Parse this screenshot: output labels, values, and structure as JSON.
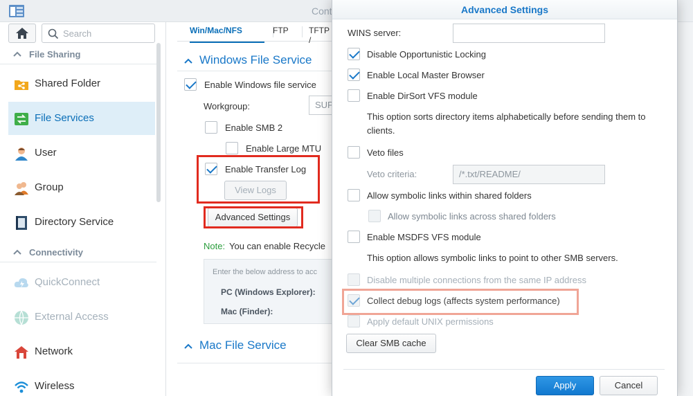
{
  "app": {
    "title": "Cont"
  },
  "sidebar": {
    "search_placeholder": "Search",
    "sections": [
      {
        "label": "File Sharing"
      },
      {
        "label": "Connectivity"
      }
    ],
    "items": [
      {
        "label": "Shared Folder"
      },
      {
        "label": "File Services"
      },
      {
        "label": "User"
      },
      {
        "label": "Group"
      },
      {
        "label": "Directory Service"
      },
      {
        "label": "QuickConnect"
      },
      {
        "label": "External Access"
      },
      {
        "label": "Network"
      },
      {
        "label": "Wireless"
      }
    ]
  },
  "main": {
    "tabs": [
      {
        "label": "Win/Mac/NFS"
      },
      {
        "label": "FTP"
      },
      {
        "label": "TFTP /"
      }
    ],
    "windows_group_title": "Windows File Service",
    "enable_windows_label": "Enable Windows file service",
    "workgroup_label": "Workgroup:",
    "workgroup_value": "SUP",
    "enable_smb2_label": "Enable SMB 2",
    "enable_large_mtu_label": "Enable Large MTU",
    "enable_transfer_log_label": "Enable Transfer Log",
    "view_logs_label": "View Logs",
    "advanced_settings_label": "Advanced Settings",
    "note_prefix": "Note:",
    "note_text": "You can enable Recycle",
    "address_intro": "Enter the below address to acc",
    "pc_label": "PC (Windows Explorer):",
    "mac_label": "Mac (Finder):",
    "mac_group_title": "Mac File Service"
  },
  "dialog": {
    "title": "Advanced Settings",
    "wins_label": "WINS server:",
    "wins_value": "",
    "opt_disable_opportunistic": "Disable Opportunistic Locking",
    "opt_local_master": "Enable Local Master Browser",
    "opt_dirsort": "Enable DirSort VFS module",
    "dirsort_help": "This option sorts directory items alphabetically before sending them to clients.",
    "opt_veto": "Veto files",
    "veto_criteria_label": "Veto criteria:",
    "veto_criteria_value": "/*.txt/README/",
    "opt_symlinks": "Allow symbolic links within shared folders",
    "opt_symlinks_across": "Allow symbolic links across shared folders",
    "opt_msdfs": "Enable MSDFS VFS module",
    "msdfs_help": "This option allows symbolic links to point to other SMB servers.",
    "opt_disable_multi": "Disable multiple connections from the same IP address",
    "opt_debug_logs": "Collect debug logs (affects system performance)",
    "opt_unix_perms": "Apply default UNIX permissions",
    "clear_cache_label": "Clear SMB cache",
    "apply_label": "Apply",
    "cancel_label": "Cancel"
  },
  "colors": {
    "accent": "#1978c8",
    "highlight_red": "#e12b1f",
    "highlight_pink": "#f0a596"
  }
}
